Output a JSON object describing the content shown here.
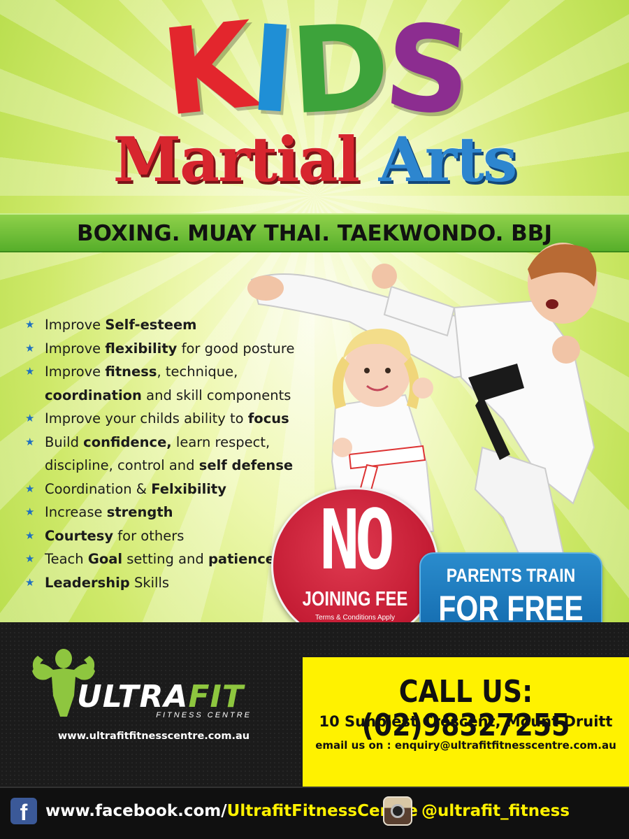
{
  "title": {
    "kids_letters": [
      "K",
      "I",
      "D",
      "S"
    ],
    "martial": "Martial",
    "arts": "Arts"
  },
  "disciplines": "BOXING. MUAY THAI. TAEKWONDO. BBJ",
  "benefits": [
    {
      "pre": "Improve ",
      "bold": "Self-esteem",
      "post": ""
    },
    {
      "pre": "Improve ",
      "bold": "flexibility",
      "post": " for good posture"
    },
    {
      "pre": "Improve ",
      "bold": "fitness",
      "post": ", technique,"
    },
    {
      "pre": "",
      "bold": "coordination",
      "post": " and skill components",
      "continuation": true
    },
    {
      "pre": "Improve your childs ability to ",
      "bold": "focus",
      "post": ""
    },
    {
      "pre": "Build ",
      "bold": "confidence,",
      "post": " learn respect,"
    },
    {
      "pre": "discipline, control and ",
      "bold": "self defense",
      "post": "",
      "continuation": true
    },
    {
      "pre": "Coordination & ",
      "bold": "Felxibility",
      "post": ""
    },
    {
      "pre": "Increase ",
      "bold": "strength",
      "post": ""
    },
    {
      "pre": "",
      "bold": "Courtesy",
      "post": " for others"
    },
    {
      "pre": "Teach ",
      "bold": "Goal",
      "post": " setting and patience",
      "bold2": "patience"
    },
    {
      "pre": "",
      "bold": "Leadership",
      "post": " Skills"
    }
  ],
  "offer": {
    "no": "NO",
    "joining_fee": "JOINING FEE",
    "terms": "Terms & Conditions Apply"
  },
  "parents": {
    "line1": "PARENTS TRAIN",
    "line2": "FOR FREE"
  },
  "brand": {
    "name_part1": "ULTRA",
    "name_part2": "FIT",
    "subtitle": "FITNESS CENTRE",
    "website": "www.ultrafitfitnesscentre.com.au"
  },
  "contact": {
    "call": "CALL US: (02)98327255",
    "address": "10 Sunblest Crescent, Mount Druitt",
    "email": "email us on : enquiry@ultrafitfitnesscentre.com.au"
  },
  "social": {
    "facebook_prefix": "www.facebook.com/",
    "facebook_page": "UltrafitFitnessCentre",
    "instagram": "@ultrafit_fitness",
    "facebook_icon_glyph": "f"
  },
  "colors": {
    "red": "#e3262d",
    "blue": "#1f8fd6",
    "green": "#3da33b",
    "purple": "#8c2d90",
    "yellow": "#fff200",
    "lime": "#8ec63f"
  }
}
